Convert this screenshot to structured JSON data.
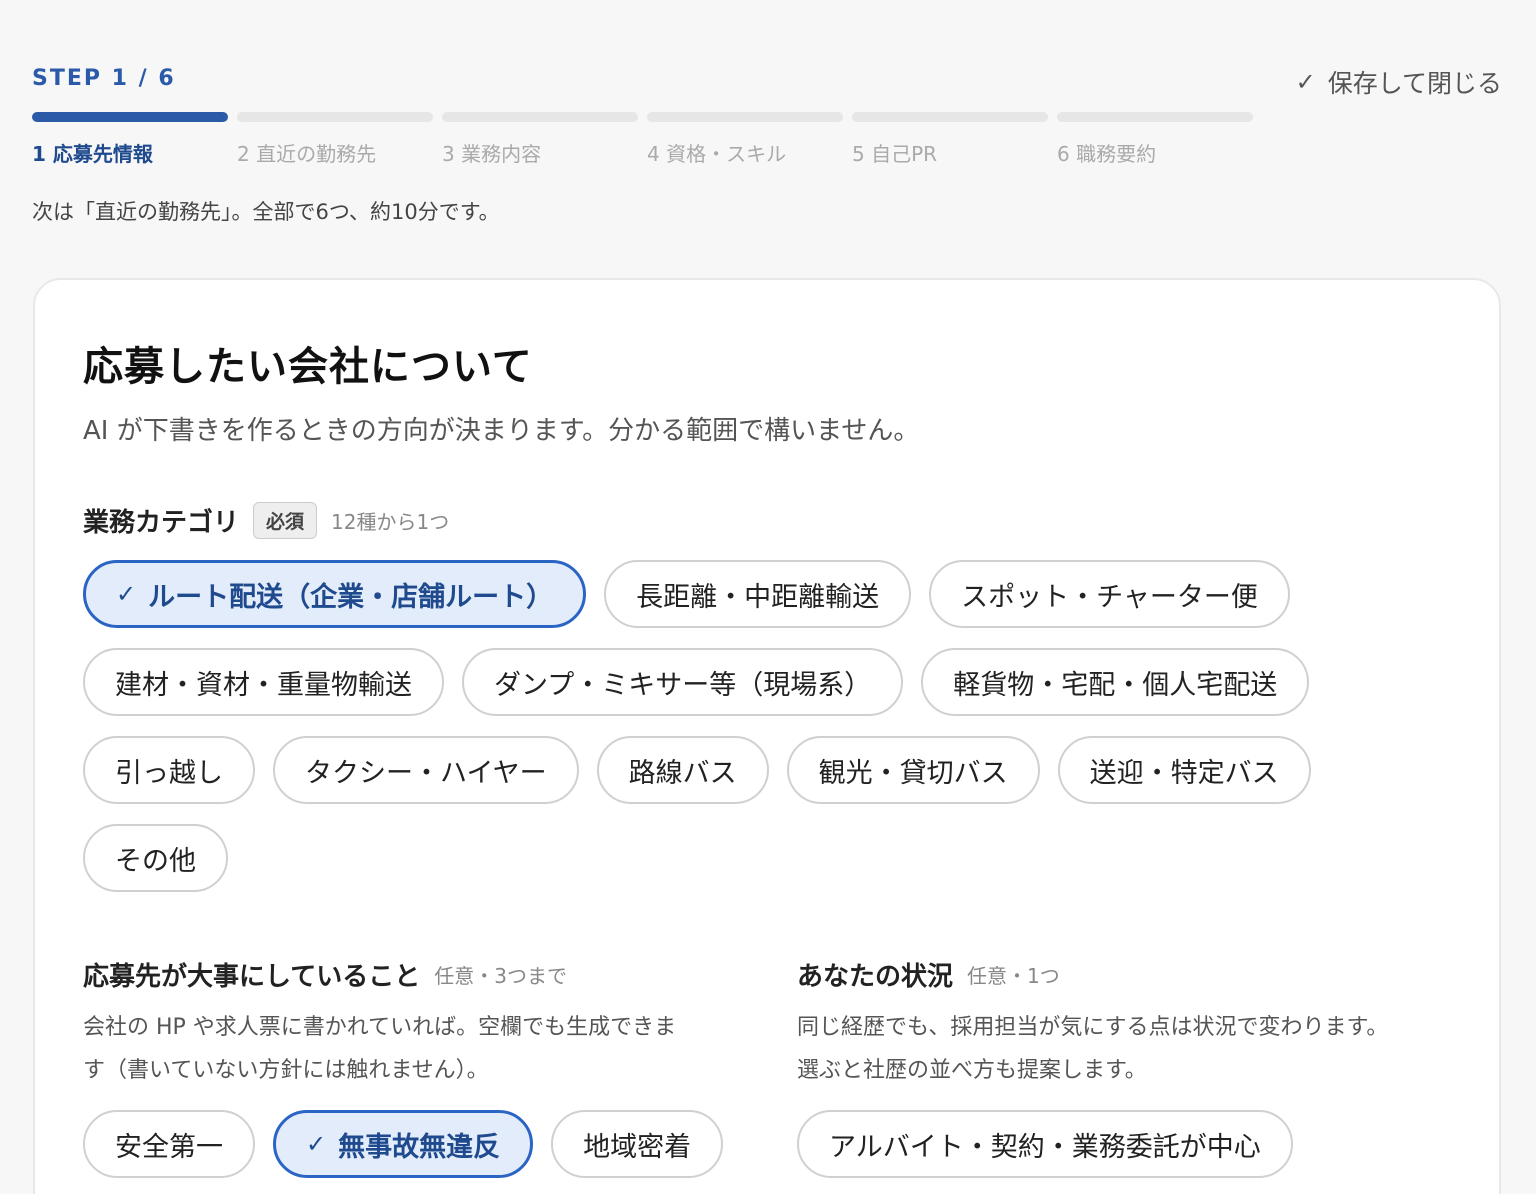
{
  "header": {
    "step_label": "STEP 1 / 6",
    "save_close": "保存して閉じる",
    "next_hint": "次は「直近の勤務先」。全部で6つ、約10分です。"
  },
  "steps": [
    {
      "label": "1 応募先情報",
      "active": true
    },
    {
      "label": "2 直近の勤務先",
      "active": false
    },
    {
      "label": "3 業務内容",
      "active": false
    },
    {
      "label": "4 資格・スキル",
      "active": false
    },
    {
      "label": "5 自己PR",
      "active": false
    },
    {
      "label": "6 職務要約",
      "active": false
    }
  ],
  "card": {
    "title": "応募したい会社について",
    "description": "AI が下書きを作るときの方向が決まります。分かる範囲で構いません。"
  },
  "category": {
    "label": "業務カテゴリ",
    "required_badge": "必須",
    "note": "12種から1つ",
    "options": [
      {
        "label": "ルート配送（企業・店舗ルート）",
        "selected": true
      },
      {
        "label": "長距離・中距離輸送",
        "selected": false
      },
      {
        "label": "スポット・チャーター便",
        "selected": false
      },
      {
        "label": "建材・資材・重量物輸送",
        "selected": false
      },
      {
        "label": "ダンプ・ミキサー等（現場系）",
        "selected": false
      },
      {
        "label": "軽貨物・宅配・個人宅配送",
        "selected": false
      },
      {
        "label": "引っ越し",
        "selected": false
      },
      {
        "label": "タクシー・ハイヤー",
        "selected": false
      },
      {
        "label": "路線バス",
        "selected": false
      },
      {
        "label": "観光・貸切バス",
        "selected": false
      },
      {
        "label": "送迎・特定バス",
        "selected": false
      },
      {
        "label": "その他",
        "selected": false
      }
    ]
  },
  "values": {
    "label": "応募先が大事にしていること",
    "note": "任意・3つまで",
    "description_lines": [
      "会社の HP や求人票に書かれていれば。空欄でも生成できま",
      "す（書いていない方針には触れません）。"
    ],
    "options": [
      {
        "label": "安全第一",
        "selected": false
      },
      {
        "label": "無事故無違反",
        "selected": true
      },
      {
        "label": "地域密着",
        "selected": false
      }
    ]
  },
  "situation": {
    "label": "あなたの状況",
    "note": "任意・1つ",
    "description_lines": [
      "同じ経歴でも、採用担当が気にする点は状況で変わります。",
      "選ぶと社歴の並べ方も提案します。"
    ],
    "options": [
      {
        "label": "アルバイト・契約・業務委託が中心",
        "selected": false
      }
    ]
  },
  "colors": {
    "accent": "#2a5aa8",
    "selected_bg": "#e2ecfa",
    "selected_border": "#2a64c4"
  },
  "icons": {
    "save": "check-icon",
    "selected_chip": "check-icon"
  }
}
